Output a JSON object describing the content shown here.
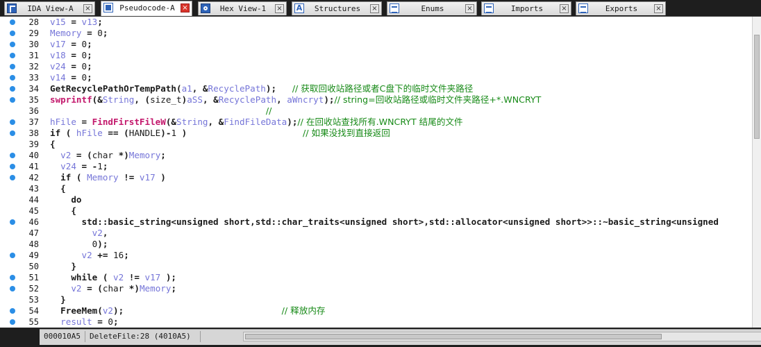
{
  "tabs": [
    {
      "label": "IDA View-A",
      "icon": "ida-view-icon",
      "active": false
    },
    {
      "label": "Pseudocode-A",
      "icon": "pseudocode-icon",
      "active": true
    },
    {
      "label": "Hex View-1",
      "icon": "hex-view-icon",
      "active": false
    },
    {
      "label": "Structures",
      "icon": "structures-icon",
      "active": false
    },
    {
      "label": "Enums",
      "icon": "enums-icon",
      "active": false
    },
    {
      "label": "Imports",
      "icon": "imports-icon",
      "active": false
    },
    {
      "label": "Exports",
      "icon": "exports-icon",
      "active": false
    }
  ],
  "tab_close_glyph": "×",
  "colors": {
    "variable": "#7575d8",
    "function": "#c3186c",
    "comment": "#178a17",
    "breakpoint_dot": "#2b8ee6",
    "active_close": "#d9342b"
  },
  "code": [
    {
      "num": "28",
      "dot": true,
      "segs": [
        [
          "v",
          "v15"
        ],
        [
          "k",
          " = "
        ],
        [
          "v",
          "v13"
        ],
        [
          "k",
          ";"
        ]
      ]
    },
    {
      "num": "29",
      "dot": true,
      "segs": [
        [
          "v",
          "Memory"
        ],
        [
          "k",
          " = "
        ],
        [
          "n",
          "0"
        ],
        [
          "k",
          ";"
        ]
      ]
    },
    {
      "num": "30",
      "dot": true,
      "segs": [
        [
          "v",
          "v17"
        ],
        [
          "k",
          " = "
        ],
        [
          "n",
          "0"
        ],
        [
          "k",
          ";"
        ]
      ]
    },
    {
      "num": "31",
      "dot": true,
      "segs": [
        [
          "v",
          "v18"
        ],
        [
          "k",
          " = "
        ],
        [
          "n",
          "0"
        ],
        [
          "k",
          ";"
        ]
      ]
    },
    {
      "num": "32",
      "dot": true,
      "segs": [
        [
          "v",
          "v24"
        ],
        [
          "k",
          " = "
        ],
        [
          "n",
          "0"
        ],
        [
          "k",
          ";"
        ]
      ]
    },
    {
      "num": "33",
      "dot": true,
      "segs": [
        [
          "v",
          "v14"
        ],
        [
          "k",
          " = "
        ],
        [
          "n",
          "0"
        ],
        [
          "k",
          ";"
        ]
      ]
    },
    {
      "num": "34",
      "dot": true,
      "segs": [
        [
          "k",
          "GetRecyclePathOrTempPath("
        ],
        [
          "v",
          "a1"
        ],
        [
          "k",
          ", &"
        ],
        [
          "v",
          "RecyclePath"
        ],
        [
          "k",
          ");   "
        ],
        [
          "c",
          "// 获取回收站路径或者C盘下的临时文件夹路径"
        ]
      ]
    },
    {
      "num": "35",
      "dot": true,
      "segs": [
        [
          "f",
          "swprintf"
        ],
        [
          "k",
          "(&"
        ],
        [
          "v",
          "String"
        ],
        [
          "k",
          ", ("
        ],
        [
          "n",
          "size_t"
        ],
        [
          "k",
          ")"
        ],
        [
          "v",
          "aSS"
        ],
        [
          "k",
          ", &"
        ],
        [
          "v",
          "RecyclePath"
        ],
        [
          "k",
          ", "
        ],
        [
          "v",
          "aWncryt"
        ],
        [
          "k",
          ");"
        ],
        [
          "c",
          "// string=回收站路径或临时文件夹路径+*.WNCRYT"
        ]
      ]
    },
    {
      "num": "36",
      "dot": false,
      "segs": [
        [
          "k",
          "                                         "
        ],
        [
          "c",
          "//"
        ]
      ]
    },
    {
      "num": "37",
      "dot": true,
      "segs": [
        [
          "v",
          "hFile"
        ],
        [
          "k",
          " = "
        ],
        [
          "f",
          "FindFirstFileW"
        ],
        [
          "k",
          "(&"
        ],
        [
          "v",
          "String"
        ],
        [
          "k",
          ", &"
        ],
        [
          "v",
          "FindFileData"
        ],
        [
          "k",
          ");"
        ],
        [
          "c",
          "// 在回收站查找所有.WNCRYT 结尾的文件"
        ]
      ]
    },
    {
      "num": "38",
      "dot": true,
      "segs": [
        [
          "k",
          "if ( "
        ],
        [
          "v",
          "hFile"
        ],
        [
          "k",
          " == ("
        ],
        [
          "n",
          "HANDLE"
        ],
        [
          "k",
          ")-"
        ],
        [
          "n",
          "1"
        ],
        [
          "k",
          " )                      "
        ],
        [
          "c",
          "// 如果没找到直接返回"
        ]
      ]
    },
    {
      "num": "39",
      "dot": false,
      "segs": [
        [
          "k",
          "{"
        ]
      ]
    },
    {
      "num": "40",
      "dot": true,
      "segs": [
        [
          "k",
          "  "
        ],
        [
          "v",
          "v2"
        ],
        [
          "k",
          " = ("
        ],
        [
          "n",
          "char"
        ],
        [
          "k",
          " *)"
        ],
        [
          "v",
          "Memory"
        ],
        [
          "k",
          ";"
        ]
      ]
    },
    {
      "num": "41",
      "dot": true,
      "segs": [
        [
          "k",
          "  "
        ],
        [
          "v",
          "v24"
        ],
        [
          "k",
          " = -"
        ],
        [
          "n",
          "1"
        ],
        [
          "k",
          ";"
        ]
      ]
    },
    {
      "num": "42",
      "dot": true,
      "segs": [
        [
          "k",
          "  if ( "
        ],
        [
          "v",
          "Memory"
        ],
        [
          "k",
          " != "
        ],
        [
          "v",
          "v17"
        ],
        [
          "k",
          " )"
        ]
      ]
    },
    {
      "num": "43",
      "dot": false,
      "segs": [
        [
          "k",
          "  {"
        ]
      ]
    },
    {
      "num": "44",
      "dot": false,
      "segs": [
        [
          "k",
          "    do"
        ]
      ]
    },
    {
      "num": "45",
      "dot": false,
      "segs": [
        [
          "k",
          "    {"
        ]
      ]
    },
    {
      "num": "46",
      "dot": true,
      "segs": [
        [
          "k",
          "      std::basic_string<unsigned short,std::char_traits<unsigned short>,std::allocator<unsigned short>>::~basic_string<unsigned"
        ]
      ]
    },
    {
      "num": "47",
      "dot": false,
      "segs": [
        [
          "k",
          "        "
        ],
        [
          "v",
          "v2"
        ],
        [
          "k",
          ","
        ]
      ]
    },
    {
      "num": "48",
      "dot": false,
      "segs": [
        [
          "k",
          "        "
        ],
        [
          "n",
          "0"
        ],
        [
          "k",
          ");"
        ]
      ]
    },
    {
      "num": "49",
      "dot": true,
      "segs": [
        [
          "k",
          "      "
        ],
        [
          "v",
          "v2"
        ],
        [
          "k",
          " += "
        ],
        [
          "n",
          "16"
        ],
        [
          "k",
          ";"
        ]
      ]
    },
    {
      "num": "50",
      "dot": false,
      "segs": [
        [
          "k",
          "    }"
        ]
      ]
    },
    {
      "num": "51",
      "dot": true,
      "segs": [
        [
          "k",
          "    while ( "
        ],
        [
          "v",
          "v2"
        ],
        [
          "k",
          " != "
        ],
        [
          "v",
          "v17"
        ],
        [
          "k",
          " );"
        ]
      ]
    },
    {
      "num": "52",
      "dot": true,
      "segs": [
        [
          "k",
          "    "
        ],
        [
          "v",
          "v2"
        ],
        [
          "k",
          " = ("
        ],
        [
          "n",
          "char"
        ],
        [
          "k",
          " *)"
        ],
        [
          "v",
          "Memory"
        ],
        [
          "k",
          ";"
        ]
      ]
    },
    {
      "num": "53",
      "dot": false,
      "segs": [
        [
          "k",
          "  }"
        ]
      ]
    },
    {
      "num": "54",
      "dot": true,
      "segs": [
        [
          "k",
          "  FreeMem("
        ],
        [
          "v",
          "v2"
        ],
        [
          "k",
          ");                              "
        ],
        [
          "c",
          "// 释放内存"
        ]
      ]
    },
    {
      "num": "55",
      "dot": true,
      "segs": [
        [
          "k",
          "  "
        ],
        [
          "v",
          "result"
        ],
        [
          "k",
          " = "
        ],
        [
          "n",
          "0"
        ],
        [
          "k",
          ";"
        ]
      ]
    }
  ],
  "status": {
    "address": "000010A5",
    "location": "DeleteFile:28 (4010A5)"
  }
}
